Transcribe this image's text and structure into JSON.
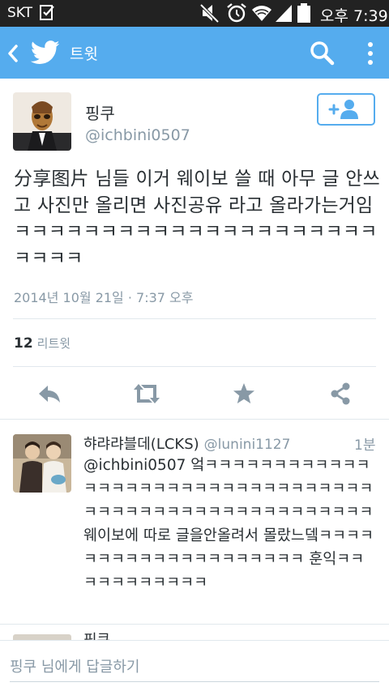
{
  "status_bar": {
    "carrier": "SKT",
    "clock": "오후 7:39",
    "icons": [
      "download-done-icon",
      "mute-icon",
      "alarm-icon",
      "wifi-icon",
      "signal-icon",
      "battery-icon"
    ]
  },
  "app_bar": {
    "title": "트윗",
    "color": "#55acee",
    "icons": [
      "back-icon",
      "twitter-bird-icon",
      "search-icon",
      "more-icon"
    ]
  },
  "tweet": {
    "author_name": "핑쿠",
    "author_handle": "@ichbini0507",
    "text": "分享图片 님들 이거 웨이보 쓸 때 아무 글 안쓰고 사진만 올리면 사진공유 라고 올라가는거임ㅋㅋㅋㅋㅋㅋㅋㅋㅋㅋㅋㅋㅋㅋㅋㅋㅋㅋㅋㅋㅋㅋㅋㅋㅋ",
    "date": "2014년 10월 21일 · 7:37 오후",
    "retweet_count": "12",
    "retweet_label": "리트윗",
    "actions": [
      "reply-icon",
      "retweet-icon",
      "favorite-icon",
      "share-icon"
    ]
  },
  "reply": {
    "author_name": "햐랴랴블데(LCKS)",
    "author_handle": "@lunini1127",
    "time": "1분",
    "text": "@ichbini0507 엌ㅋㅋㅋㅋㅋㅋㅋㅋㅋㅋㅋㅋㅋㅋㅋㅋㅋㅋㅋㅋㅋㅋㅋㅋㅋㅋㅋㅋㅋㅋㅋㅋㅋㅋㅋㅋㅋㅋㅋㅋㅋㅋㅋㅋㅋㅋㅋㅋㅋㅋㅋㅋㅋㅋ웨이보에 따로 글을안올려서 몰랐느뎈ㅋㅋㅋㅋㅋㅋㅋㅋㅋㅋㅋㅋㅋㅋㅋㅋㅋㅋㅋㅋ 훈익ㅋㅋㅋㅋㅋㅋㅋㅋㅋㅋㅋ"
  },
  "next_item_peek": {
    "author_name": "핑쿠"
  },
  "compose": {
    "placeholder": "핑쿠 님에게 답글하기"
  }
}
